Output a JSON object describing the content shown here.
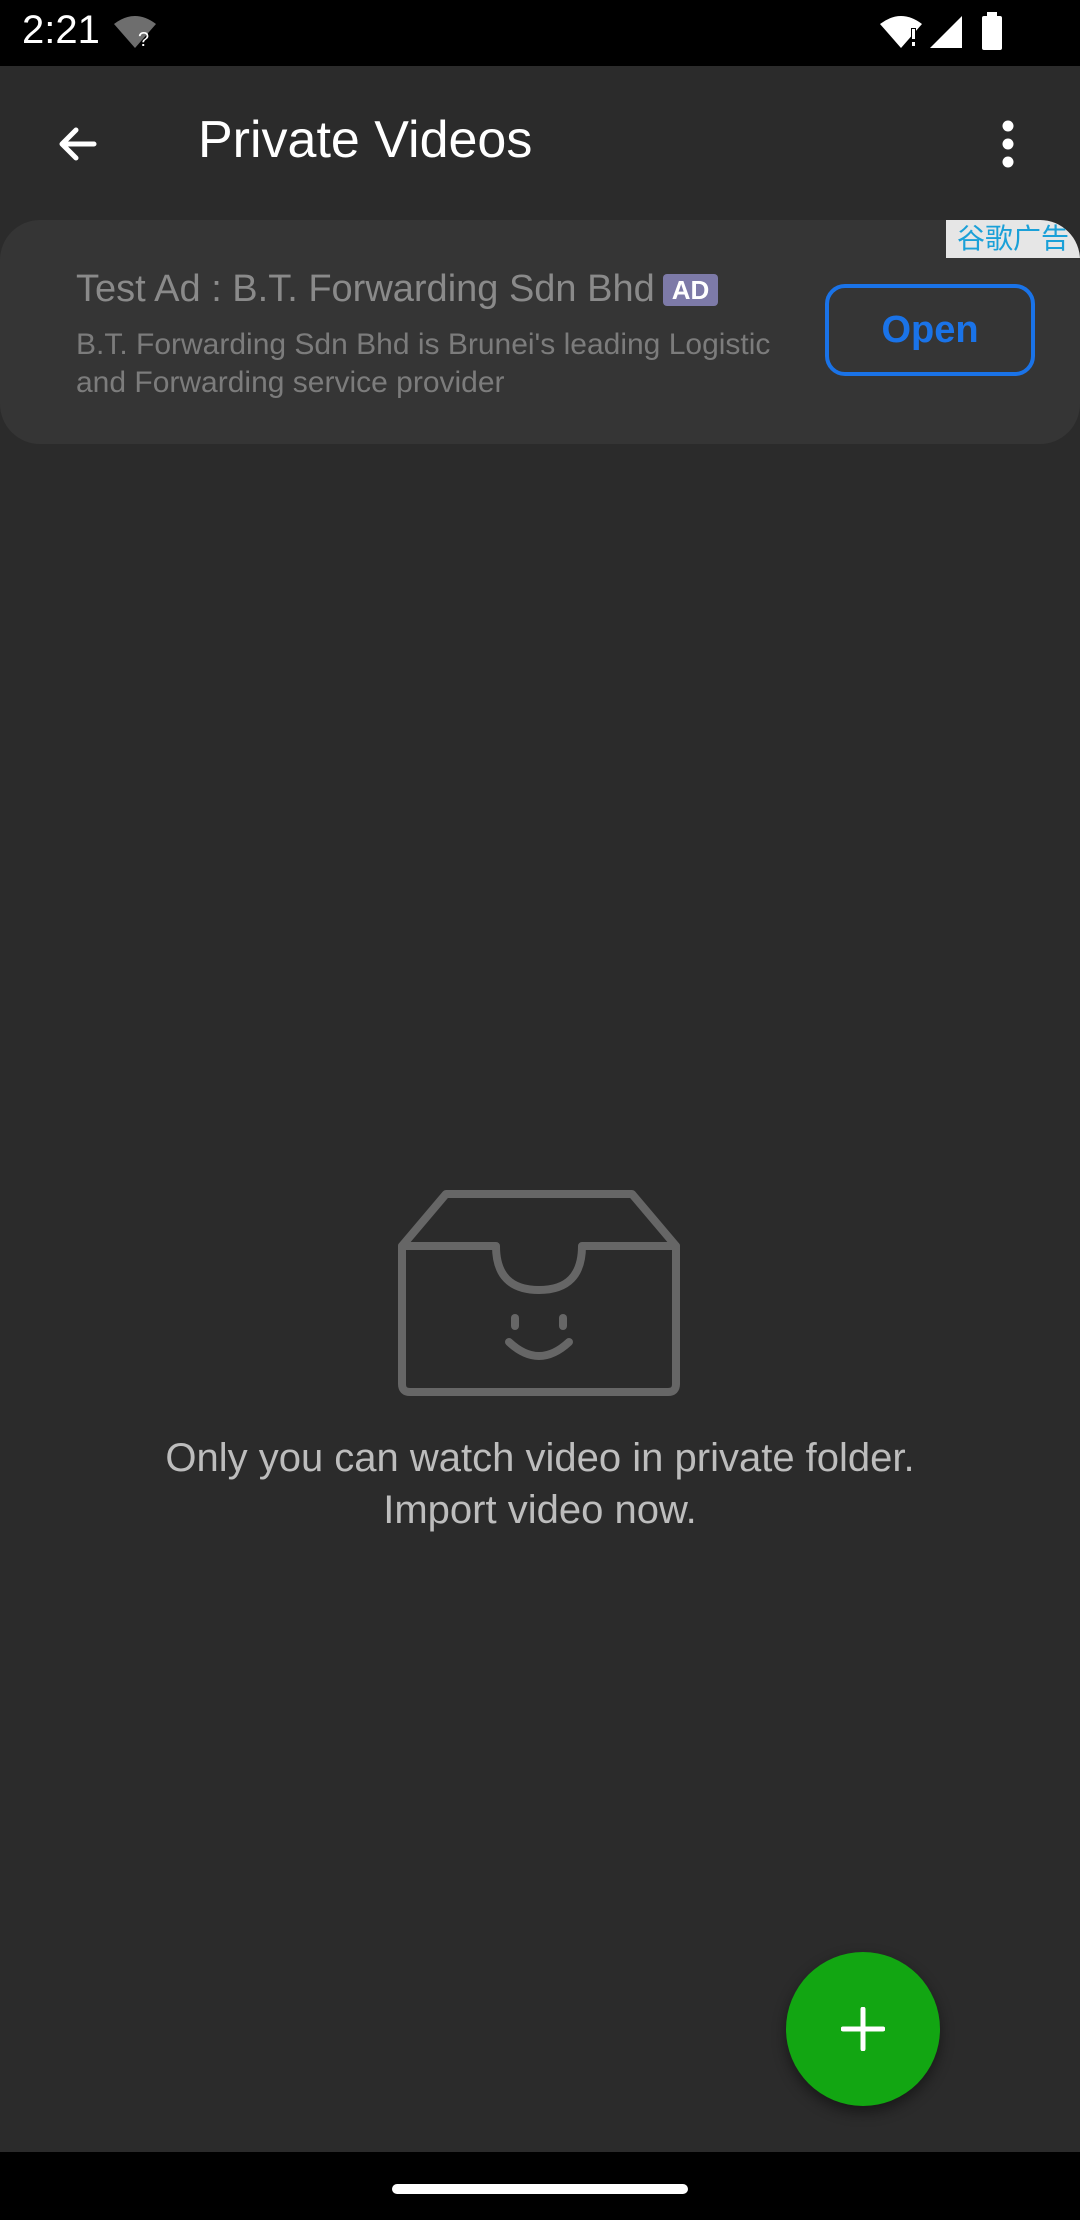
{
  "status_bar": {
    "time": "2:21",
    "icons": [
      "wifi-unknown-icon",
      "wifi-alert-icon",
      "cell-signal-icon",
      "battery-icon"
    ]
  },
  "app_bar": {
    "title": "Private Videos",
    "back_icon": "arrow-back-icon",
    "menu_icon": "more-vert-icon"
  },
  "ad": {
    "corner_label": "谷歌广告",
    "title": "Test Ad : B.T. Forwarding Sdn Bhd",
    "badge": "AD",
    "description": "B.T. Forwarding Sdn Bhd is Brunei's leading Logistic and Forwarding service provider",
    "cta": "Open",
    "cta_color": "#1a73e8"
  },
  "empty_state": {
    "icon": "smiling-box-icon",
    "message": "Only you can watch video in private folder. Import video now."
  },
  "fab": {
    "icon": "plus-icon",
    "color": "#12a612"
  },
  "colors": {
    "background": "#2b2b2b",
    "ad_card": "#353535"
  }
}
